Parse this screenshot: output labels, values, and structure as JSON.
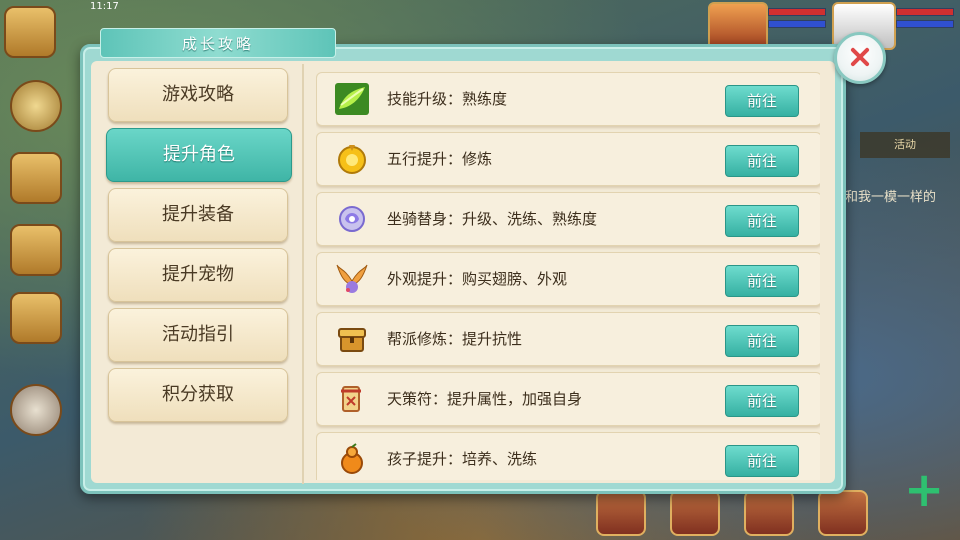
{
  "status": {
    "time": "11:17"
  },
  "background": {
    "side_buttons": [
      "",
      "",
      "",
      "",
      ""
    ],
    "hint_text": "和我一模一样的",
    "tab_label": "活动",
    "bottom_buttons": [
      "",
      "",
      "",
      "",
      ""
    ]
  },
  "panel": {
    "title": "成长攻略",
    "menu": [
      {
        "label": "游戏攻略",
        "active": false
      },
      {
        "label": "提升角色",
        "active": true
      },
      {
        "label": "提升装备",
        "active": false
      },
      {
        "label": "提升宠物",
        "active": false
      },
      {
        "label": "活动指引",
        "active": false
      },
      {
        "label": "积分获取",
        "active": false
      }
    ],
    "rows": [
      {
        "icon": "skill-leaf-icon",
        "label": "技能升级：熟练度",
        "button": "前往"
      },
      {
        "icon": "five-elements-icon",
        "label": "五行提升：修炼",
        "button": "前往"
      },
      {
        "icon": "mount-orb-icon",
        "label": "坐骑替身：升级、洗练、熟练度",
        "button": "前往"
      },
      {
        "icon": "wings-icon",
        "label": "外观提升：购买翅膀、外观",
        "button": "前往"
      },
      {
        "icon": "guild-chest-icon",
        "label": "帮派修炼：提升抗性",
        "button": "前往"
      },
      {
        "icon": "scroll-talisman-icon",
        "label": "天策符：提升属性，加强自身",
        "button": "前往"
      },
      {
        "icon": "child-gourd-icon",
        "label": "孩子提升：培养、洗练",
        "button": "前往"
      }
    ]
  },
  "colors": {
    "accent": "#3fb5a6",
    "panel": "#9fd9d2",
    "card": "#f7efdd",
    "close": "#e04848"
  }
}
